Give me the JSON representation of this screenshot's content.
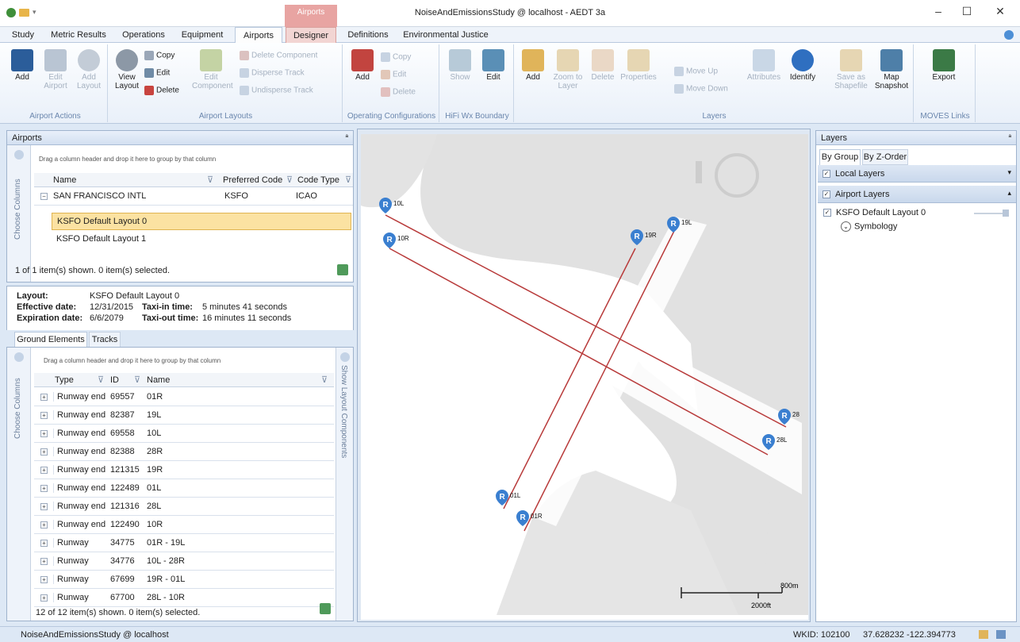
{
  "window": {
    "title": "NoiseAndEmissionsStudy @ localhost - AEDT 3a",
    "context_tab": "Airports",
    "minimize": "–",
    "maximize": "☐",
    "close": "✕"
  },
  "tabs": [
    "Study",
    "Metric Results",
    "Operations",
    "Equipment",
    "Airports",
    "Designer",
    "Definitions",
    "Environmental Justice"
  ],
  "ribbon": {
    "airport_actions": {
      "label": "Airport Actions",
      "add": "Add",
      "edit": "Edit Airport",
      "add_layout": "Add Layout"
    },
    "airport_layouts": {
      "label": "Airport Layouts",
      "view_layout": "View Layout",
      "copy": "Copy",
      "edit": "Edit",
      "delete": "Delete",
      "edit_component": "Edit Component",
      "delete_component": "Delete Component",
      "disperse_track": "Disperse Track",
      "undisperse_track": "Undisperse Track"
    },
    "operating_configurations": {
      "label": "Operating Configurations",
      "add": "Add",
      "copy": "Copy",
      "edit": "Edit",
      "delete": "Delete"
    },
    "hifi": {
      "label": "HiFi Wx Boundary",
      "show": "Show",
      "edit": "Edit"
    },
    "layers": {
      "label": "Layers",
      "add": "Add",
      "zoom": "Zoom to Layer",
      "delete": "Delete",
      "properties": "Properties",
      "move_up": "Move Up",
      "move_down": "Move Down",
      "attributes": "Attributes",
      "identify": "Identify",
      "save_shapefile": "Save as Shapefile",
      "map_snapshot": "Map Snapshot"
    },
    "moves": {
      "label": "MOVES Links",
      "export": "Export"
    }
  },
  "airports_panel": {
    "title": "Airports",
    "pin": "ª",
    "group_hint": "Drag a column header and drop it here to group by that column",
    "choose_columns": "Choose Columns",
    "columns": [
      "Name",
      "Preferred Code",
      "Code Type"
    ],
    "row": {
      "name": "SAN FRANCISCO INTL",
      "code": "KSFO",
      "type": "ICAO"
    },
    "layouts": [
      "KSFO Default Layout 0",
      "KSFO Default Layout 1"
    ],
    "status": "1 of 1 item(s) shown. 0 item(s) selected."
  },
  "layout_info": {
    "layout_label": "Layout:",
    "layout": "KSFO Default Layout 0",
    "eff_label": "Effective date:",
    "eff": "12/31/2015",
    "exp_label": "Expiration date:",
    "exp": "6/6/2079",
    "taxiin_label": "Taxi-in time:",
    "taxiin": "5 minutes 41 seconds",
    "taxiout_label": "Taxi-out time:",
    "taxiout": "16 minutes 11 seconds"
  },
  "ground": {
    "tabs": [
      "Ground Elements",
      "Tracks"
    ],
    "group_hint": "Drag a column header and drop it here to group by that column",
    "choose_columns": "Choose Columns",
    "show_layout": "Show Layout Components",
    "columns": [
      "Type",
      "ID",
      "Name"
    ],
    "rows": [
      {
        "type": "Runway end",
        "id": "69557",
        "name": "01R"
      },
      {
        "type": "Runway end",
        "id": "82387",
        "name": "19L"
      },
      {
        "type": "Runway end",
        "id": "69558",
        "name": "10L"
      },
      {
        "type": "Runway end",
        "id": "82388",
        "name": "28R"
      },
      {
        "type": "Runway end",
        "id": "121315",
        "name": "19R"
      },
      {
        "type": "Runway end",
        "id": "122489",
        "name": "01L"
      },
      {
        "type": "Runway end",
        "id": "121316",
        "name": "28L"
      },
      {
        "type": "Runway end",
        "id": "122490",
        "name": "10R"
      },
      {
        "type": "Runway",
        "id": "34775",
        "name": "01R - 19L"
      },
      {
        "type": "Runway",
        "id": "34776",
        "name": "10L - 28R"
      },
      {
        "type": "Runway",
        "id": "67699",
        "name": "19R - 01L"
      },
      {
        "type": "Runway",
        "id": "67700",
        "name": "28L - 10R"
      }
    ],
    "status": "12 of 12 item(s) shown. 0 item(s) selected."
  },
  "map": {
    "markers": [
      "10L",
      "10R",
      "19R",
      "19L",
      "28",
      "28L",
      "01L",
      "01R"
    ],
    "marker_glyph": "R",
    "scale_m": "800m",
    "scale_ft": "2000ft",
    "runway_color": "#b83a3a"
  },
  "layers_panel": {
    "title": "Layers",
    "pin": "ª",
    "tabs": [
      "By Group",
      "By Z-Order"
    ],
    "local": "Local Layers",
    "airport": "Airport Layers",
    "item": "KSFO Default Layout 0",
    "symbology": "Symbology"
  },
  "statusbar": {
    "left": "NoiseAndEmissionsStudy @ localhost",
    "wkid": "WKID: 102100",
    "coords": "37.628232 -122.394773"
  }
}
